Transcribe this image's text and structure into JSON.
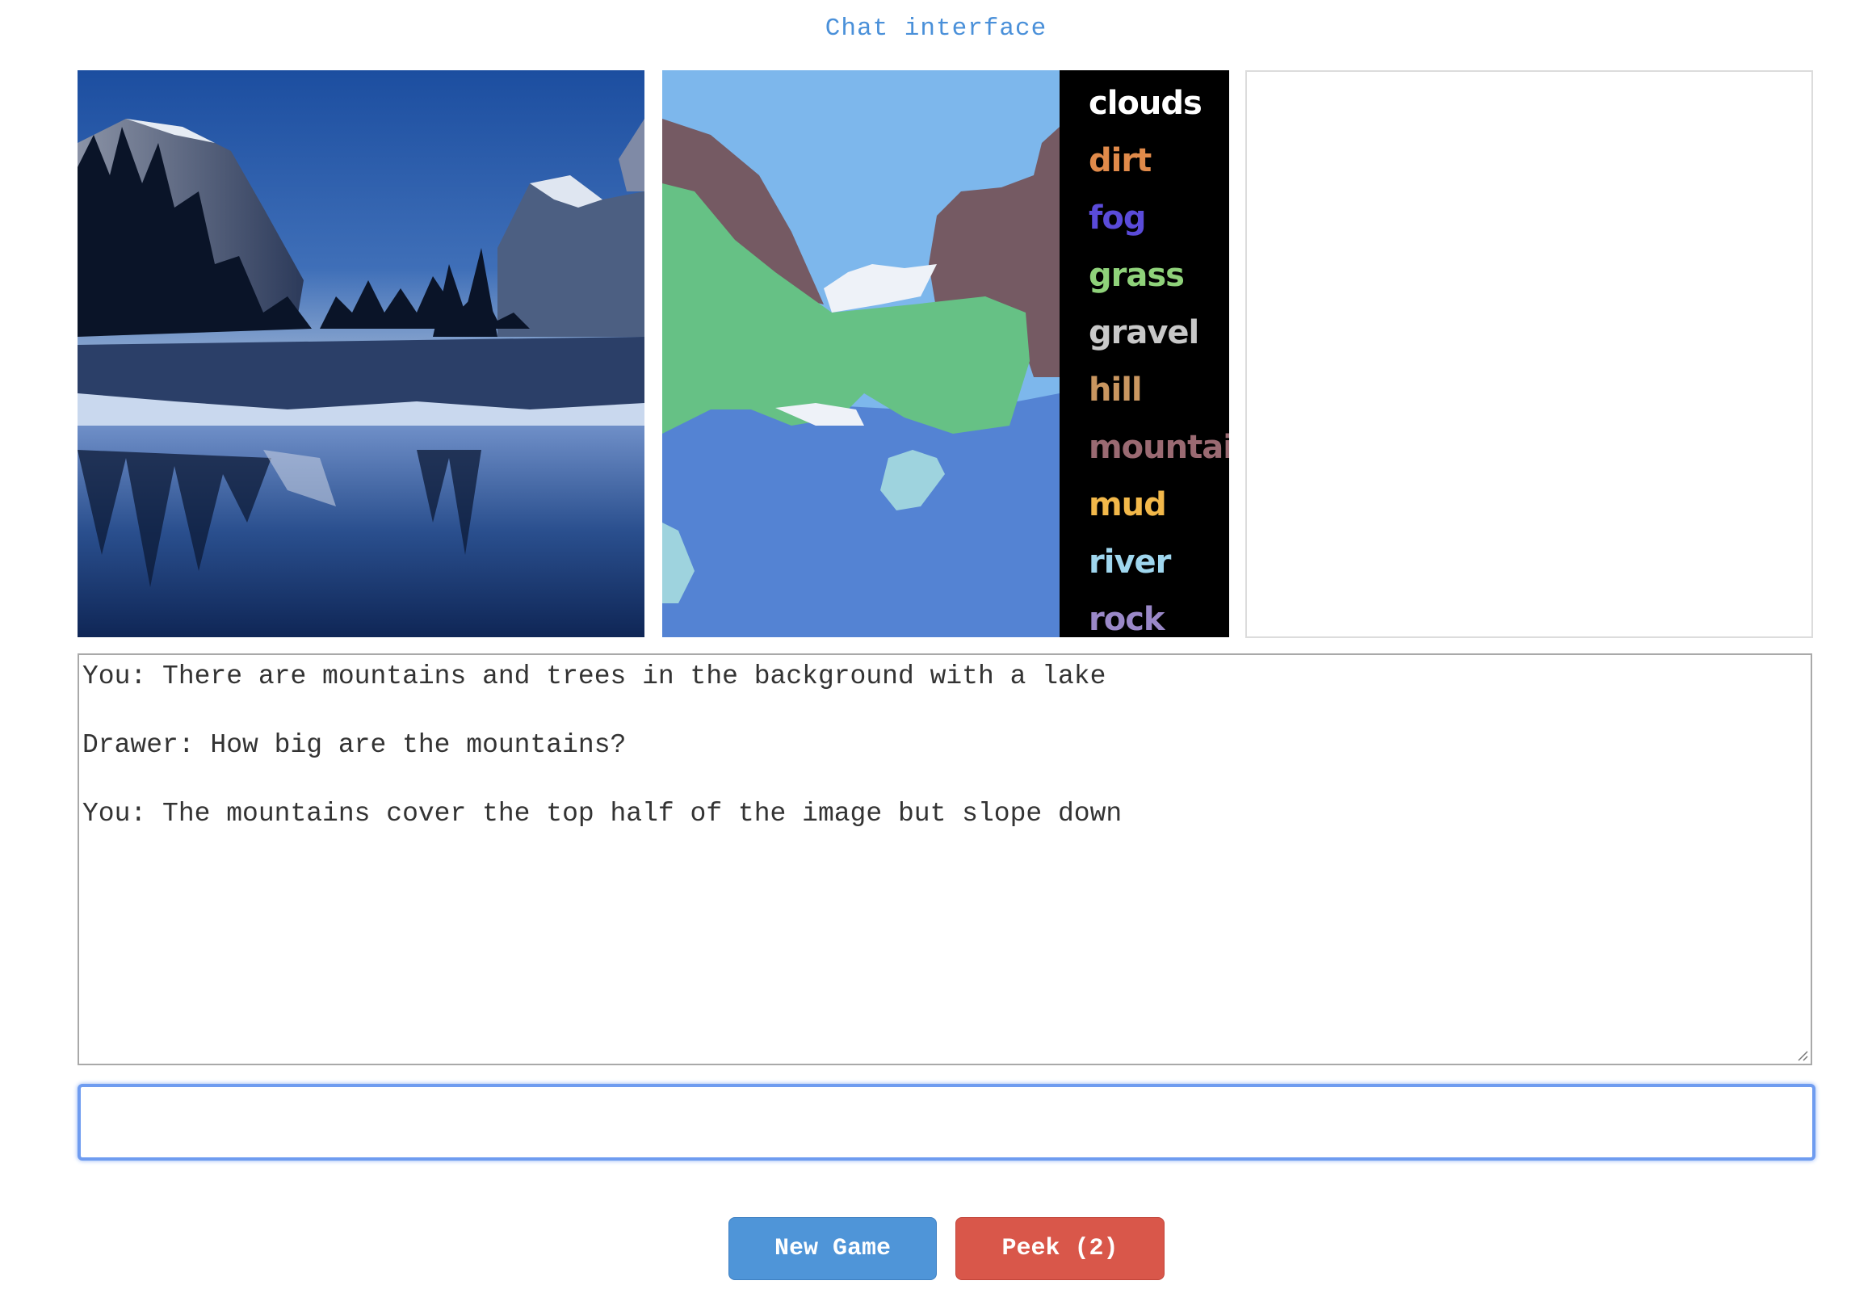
{
  "page_title": "Chat interface",
  "segmentation_legend": [
    {
      "label": "clouds",
      "color": "#ffffff"
    },
    {
      "label": "dirt",
      "color": "#e08a4a"
    },
    {
      "label": "fog",
      "color": "#5a4bd9"
    },
    {
      "label": "grass",
      "color": "#8fd27a"
    },
    {
      "label": "gravel",
      "color": "#c8c8c8"
    },
    {
      "label": "hill",
      "color": "#c99660"
    },
    {
      "label": "mountain",
      "color": "#9a6a72"
    },
    {
      "label": "mud",
      "color": "#f2b84a"
    },
    {
      "label": "river",
      "color": "#9fd6ee"
    },
    {
      "label": "rock",
      "color": "#9a88c8"
    }
  ],
  "segment_colors": {
    "sky": "#7db7ec",
    "mountain": "#755a63",
    "grass": "#66c185",
    "water": "#5483d3",
    "clouds": "#eef2f8",
    "river": "#9ed3de"
  },
  "chat": {
    "messages": [
      "You: There are mountains and trees in the background with a lake",
      "Drawer: How big are the mountains?",
      "You: The mountains cover the top half of the image but slope down"
    ],
    "input_value": ""
  },
  "buttons": {
    "new_game": "New Game",
    "peek": "Peek (2)"
  }
}
